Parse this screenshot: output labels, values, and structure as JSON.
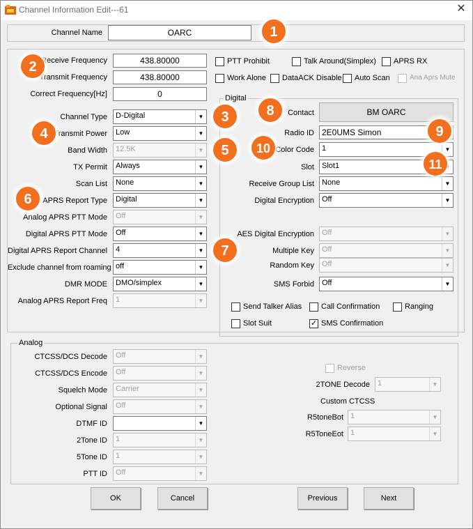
{
  "window": {
    "title": "Channel Information Edit---61",
    "close_glyph": "✕",
    "app_icon": "radio-app-icon"
  },
  "channel_name": {
    "label": "Channel Name",
    "value": "OARC"
  },
  "freq": {
    "receive_label": "Receive Frequency",
    "receive_value": "438.80000",
    "transmit_label": "Transmit Frequency",
    "transmit_value": "438.80000",
    "correct_label": "Correct Frequency[Hz]",
    "correct_value": "0"
  },
  "checks_top": {
    "ptt_prohibit": "PTT Prohibit",
    "talk_around": "Talk Around(Simplex)",
    "aprs_rx": "APRS RX",
    "work_alone": "Work Alone",
    "dataack_disable": "DataACK Disable",
    "auto_scan": "Auto Scan",
    "ana_aprs_mute": "Ana Aprs Mute"
  },
  "left_fields": [
    {
      "label": "Channel Type",
      "value": "D-Digital",
      "enabled": true
    },
    {
      "label": "Transmit Power",
      "value": "Low",
      "enabled": true
    },
    {
      "label": "Band Width",
      "value": "12.5K",
      "enabled": false
    },
    {
      "label": "TX Permit",
      "value": "Always",
      "enabled": true
    },
    {
      "label": "Scan List",
      "value": "None",
      "enabled": true
    },
    {
      "label": "APRS Report Type",
      "value": "Digital",
      "enabled": true
    },
    {
      "label": "Analog APRS PTT Mode",
      "value": "Off",
      "enabled": false
    },
    {
      "label": "Digital APRS PTT Mode",
      "value": "Off",
      "enabled": true
    },
    {
      "label": "Digital APRS Report Channel",
      "value": "4",
      "enabled": true
    },
    {
      "label": "Exclude channel from roaming",
      "value": "off",
      "enabled": true
    },
    {
      "label": "DMR MODE",
      "value": "DMO/simplex",
      "enabled": true
    },
    {
      "label": "Analog APRS Report Freq",
      "value": "1",
      "enabled": false
    }
  ],
  "digital": {
    "group_title": "Digital",
    "contact_label": "Contact",
    "contact_button": "BM OARC",
    "radio_id_label": "Radio ID",
    "radio_id_value": "2E0UMS Simon",
    "color_code_label": "Color Code",
    "color_code_value": "1",
    "slot_label": "Slot",
    "slot_value": "Slot1",
    "rx_group_label": "Receive Group List",
    "rx_group_value": "None",
    "encryption_label": "Digital Encryption",
    "encryption_value": "Off",
    "aes_label": "AES Digital Encryption",
    "aes_value": "Off",
    "multiple_key_label": "Multiple Key",
    "multiple_key_value": "Off",
    "random_key_label": "Random Key",
    "random_key_value": "Off",
    "sms_forbid_label": "SMS Forbid",
    "sms_forbid_value": "Off",
    "send_talker_alias": "Send Talker Alias",
    "call_confirmation": "Call Confirmation",
    "ranging": "Ranging",
    "slot_suit": "Slot Suit",
    "sms_confirmation": "SMS Confirmation",
    "sms_confirmation_checked": "✓"
  },
  "analog": {
    "group_title": "Analog",
    "fields": [
      {
        "label": "CTCSS/DCS Decode",
        "value": "Off"
      },
      {
        "label": "CTCSS/DCS Encode",
        "value": "Off"
      },
      {
        "label": "Squelch Mode",
        "value": "Carrier"
      },
      {
        "label": "Optional Signal",
        "value": "Off"
      },
      {
        "label": "DTMF ID",
        "value": ""
      },
      {
        "label": "2Tone ID",
        "value": "1"
      },
      {
        "label": "5Tone ID",
        "value": "1"
      },
      {
        "label": "PTT ID",
        "value": "Off"
      }
    ],
    "reverse_label": "Reverse",
    "two_tone_decode_label": "2TONE Decode",
    "two_tone_decode_value": "1",
    "custom_ctcss_label": "Custom CTCSS",
    "r5tone_bot_label": "R5toneBot",
    "r5tone_bot_value": "1",
    "r5tone_eot_label": "R5ToneEot",
    "r5tone_eot_value": "1"
  },
  "buttons": {
    "ok": "OK",
    "cancel": "Cancel",
    "previous": "Previous",
    "next": "Next"
  },
  "badges": [
    "1",
    "2",
    "3",
    "4",
    "5",
    "6",
    "7",
    "8",
    "9",
    "10",
    "11"
  ],
  "colors": {
    "badge": "#f26f1e",
    "dialog_bg": "#f0f0f0"
  }
}
